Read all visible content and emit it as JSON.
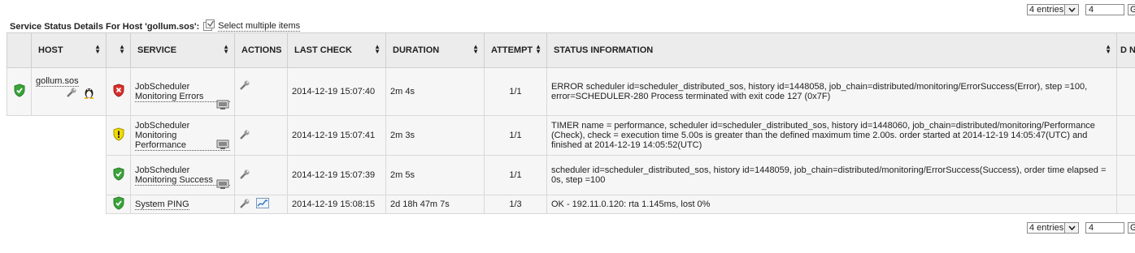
{
  "pager_top": {
    "entries": "4 entries",
    "page": "4",
    "go": "G"
  },
  "pager_bottom": {
    "entries": "4 entries",
    "page": "4",
    "go": "G"
  },
  "title": "Service Status Details For Host 'gollum.sos':",
  "select_multiple": "Select multiple items",
  "columns": {
    "host": "HOST",
    "service": "SERVICE",
    "actions": "ACTIONS",
    "last_check": "LAST CHECK",
    "duration": "DURATION",
    "attempt": "ATTEMPT",
    "status_info": "STATUS INFORMATION",
    "extra": "D N"
  },
  "host": {
    "name": "gollum.sos",
    "status": "ok"
  },
  "rows": [
    {
      "status": "critical",
      "service": "JobScheduler Monitoring Errors",
      "last_check": "2014-12-19 15:07:40",
      "duration": "2m 4s",
      "attempt": "1/1",
      "info": "ERROR scheduler id=scheduler_distributed_sos, history id=1448058, job_chain=distributed/monitoring/ErrorSuccess(Error), step =100, error=SCHEDULER-280 Process terminated with exit code 127 (0x7F)"
    },
    {
      "status": "warning",
      "service": "JobScheduler Monitoring Performance",
      "last_check": "2014-12-19 15:07:41",
      "duration": "2m 3s",
      "attempt": "1/1",
      "info": "TIMER name = performance, scheduler id=scheduler_distributed_sos, history id=1448060, job_chain=distributed/monitoring/Performance (Check), check = execution time 5.00s is greater than the defined maximum time 2.00s. order started at 2014-12-19 14:05:47(UTC) and finished at 2014-12-19 14:05:52(UTC)"
    },
    {
      "status": "ok",
      "service": "JobScheduler Monitoring Success",
      "last_check": "2014-12-19 15:07:39",
      "duration": "2m 5s",
      "attempt": "1/1",
      "info": "scheduler id=scheduler_distributed_sos, history id=1448059, job_chain=distributed/monitoring/ErrorSuccess(Success), order time elapsed = 0s, step =100"
    },
    {
      "status": "ok",
      "service": "System PING",
      "last_check": "2014-12-19 15:08:15",
      "duration": "2d 18h 47m 7s",
      "attempt": "1/3",
      "info": "OK - 192.11.0.120: rta 1.145ms, lost 0%"
    }
  ],
  "colors": {
    "ok": "#3aa43a",
    "critical": "#d9302b",
    "warning": "#e8d200",
    "header_bg": "#ececec"
  }
}
